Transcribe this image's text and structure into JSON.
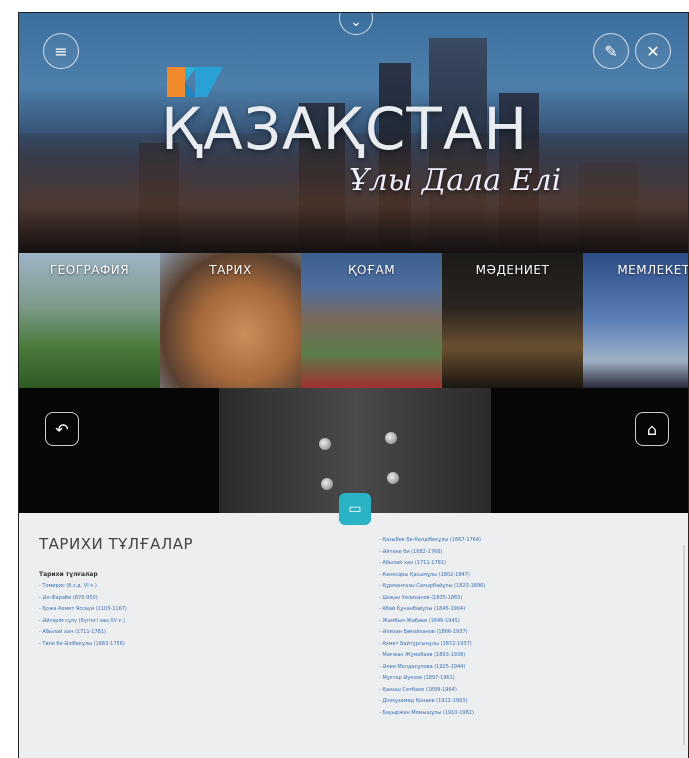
{
  "hero": {
    "title": "ҚАЗАҚСТАН",
    "subtitle": "Ұлы Дала Елі",
    "menu_icon": "≡",
    "close_icon": "✕",
    "edit_icon": "✎",
    "chevron_icon": "⌄"
  },
  "categories": [
    {
      "label": "ГЕОГРАФИЯ"
    },
    {
      "label": "ТАРИХ"
    },
    {
      "label": "ҚОҒАМ"
    },
    {
      "label": "МӘДЕНИЕТ"
    },
    {
      "label": "МЕМЛЕКЕТ"
    }
  ],
  "nav": {
    "back_icon": "↶",
    "home_icon": "⌂",
    "center_icon": "▭"
  },
  "content": {
    "heading": "ТАРИХИ ТҰЛҒАЛАР",
    "subheading": "Тарихи тұлғалар",
    "left_links": [
      "- Томирис (б.з.д. VI ғ.)",
      "- Әл-Фараби (870-950)",
      "- Қожа Ахмет Яссауи (1103-1167)",
      "- Әйгерім сұлу (бүгінгі заң XV ғ.)",
      "- Абылай хан (1711-1781)",
      "- Төле би Әлібекұлы (1663-1756)"
    ],
    "right_links": [
      "- Қазыбек би Келдібекұлы (1667-1764)",
      "- Әйтеке би (1682-1766)",
      "- Абылай хан (1711-1781)",
      "- Кенесары Қасымұлы (1802-1847)",
      "- Құрманғазы Сағырбайұлы (1823-1896)",
      "- Шоқан Уәлиханов (1835-1865)",
      "- Абай Құнанбайұлы (1845-1904)",
      "- Жамбыл Жабаев (1846-1945)",
      "- Әлихан Бөкейханов (1866-1937)",
      "- Ахмет Байтұрсынұлы (1872-1937)",
      "- Мағжан Жұмабаев (1893-1938)",
      "- Әлия Молдағұлова (1925-1944)",
      "- Мұхтар Әуезов (1897-1961)",
      "- Қаныш Сәтбаев (1899-1964)",
      "- Дінмұхамед Қонаев (1912-1993)",
      "- Бауыржан Момышұлы (1910-1982)"
    ]
  }
}
